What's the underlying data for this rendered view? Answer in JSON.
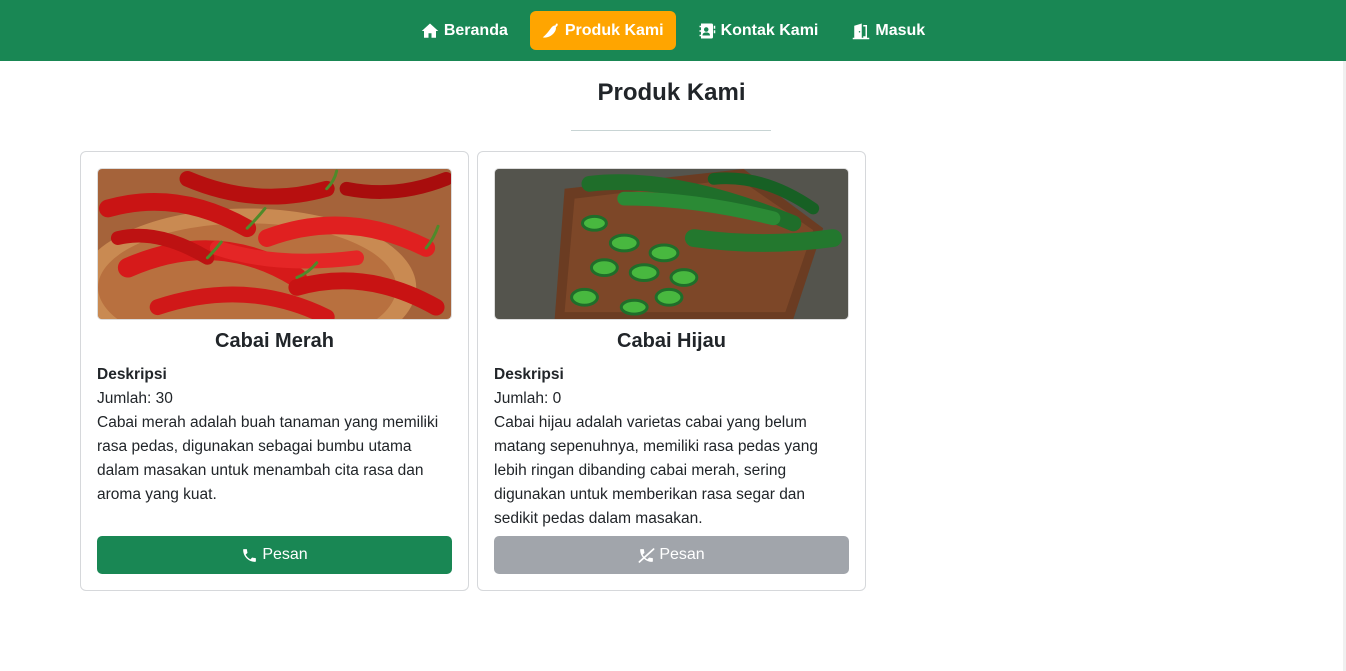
{
  "nav": {
    "items": [
      {
        "label": "Beranda",
        "icon": "home-icon",
        "active": false
      },
      {
        "label": "Produk Kami",
        "icon": "chili-icon",
        "active": true
      },
      {
        "label": "Kontak Kami",
        "icon": "address-book-icon",
        "active": false
      },
      {
        "label": "Masuk",
        "icon": "door-open-icon",
        "active": false
      }
    ]
  },
  "page": {
    "title": "Produk Kami"
  },
  "products": [
    {
      "name": "Cabai Merah",
      "desc_label": "Deskripsi",
      "quantity": "Jumlah: 30",
      "description": "Cabai merah adalah buah tanaman yang memiliki rasa pedas, digunakan sebagai bumbu utama dalam masakan untuk menambah cita rasa dan aroma yang kuat.",
      "button_label": "Pesan",
      "button_icon": "phone-icon",
      "available": true
    },
    {
      "name": "Cabai Hijau",
      "desc_label": "Deskripsi",
      "quantity": "Jumlah: 0",
      "description": "Cabai hijau adalah varietas cabai yang belum matang sepenuhnya, memiliki rasa pedas yang lebih ringan dibanding cabai merah, sering digunakan untuk memberikan rasa segar dan sedikit pedas dalam masakan.",
      "button_label": "Pesan",
      "button_icon": "phone-slash-icon",
      "available": false
    }
  ],
  "colors": {
    "navbar": "#198754",
    "active_nav": "#ffa500",
    "button_enabled": "#198754",
    "button_disabled": "#a1a5ab"
  }
}
